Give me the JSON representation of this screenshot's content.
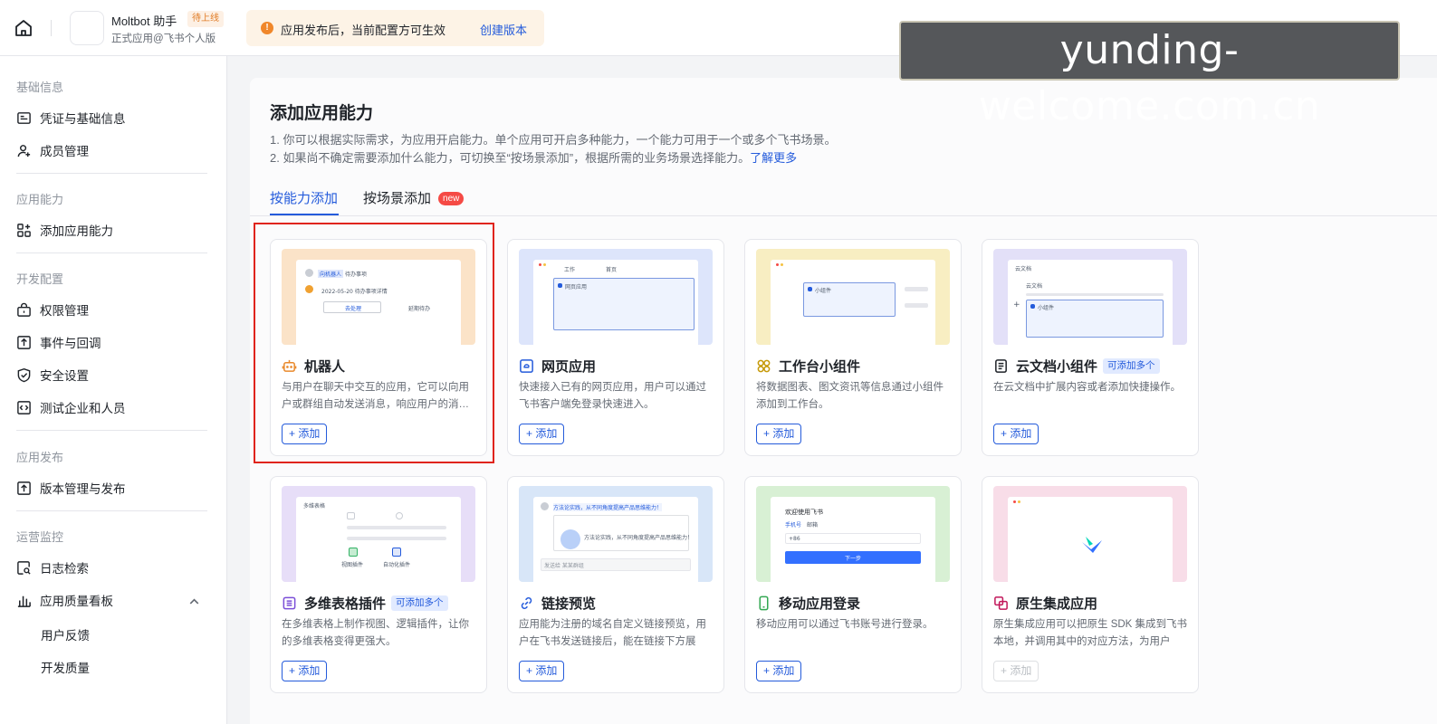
{
  "topbar": {
    "app_name": "Moltbot 助手",
    "app_status": "待上线",
    "app_subtitle": "正式应用@飞书个人版",
    "notice_text": "应用发布后，当前配置方可生效",
    "notice_link": "创建版本",
    "watermark": "yunding-welcome.com.cn"
  },
  "sidebar": {
    "groups": [
      {
        "label": "基础信息",
        "items": [
          {
            "label": "凭证与基础信息",
            "icon": "credential-icon"
          },
          {
            "label": "成员管理",
            "icon": "member-icon"
          }
        ]
      },
      {
        "label": "应用能力",
        "items": [
          {
            "label": "添加应用能力",
            "icon": "add-capability-icon"
          }
        ]
      },
      {
        "label": "开发配置",
        "items": [
          {
            "label": "权限管理",
            "icon": "permission-icon"
          },
          {
            "label": "事件与回调",
            "icon": "event-icon"
          },
          {
            "label": "安全设置",
            "icon": "shield-icon"
          },
          {
            "label": "测试企业和人员",
            "icon": "code-icon"
          }
        ]
      },
      {
        "label": "应用发布",
        "items": [
          {
            "label": "版本管理与发布",
            "icon": "upload-icon"
          }
        ]
      },
      {
        "label": "运营监控",
        "items": [
          {
            "label": "日志检索",
            "icon": "log-search-icon"
          },
          {
            "label": "应用质量看板",
            "icon": "chart-icon"
          }
        ]
      }
    ],
    "subitems": [
      "用户反馈",
      "开发质量"
    ]
  },
  "main": {
    "title": "添加应用能力",
    "desc_line1": "1. 你可以根据实际需求，为应用开启能力。单个应用可开启多种能力，一个能力可用于一个或多个飞书场景。",
    "desc_line2": "2. 如果尚不确定需要添加什么能力，可切换至“按场景添加”，根据所需的业务场景选择能力。",
    "desc_link": "了解更多",
    "tabs": [
      {
        "label": "按能力添加",
        "active": true
      },
      {
        "label": "按场景添加",
        "badge": "new"
      }
    ],
    "add_label": "+ 添加",
    "multi_label": "可添加多个",
    "cards": [
      {
        "title": "机器人",
        "desc": "与用户在聊天中交互的应用，它可以向用户或群组自动发送消息，响应用户的消…",
        "icon": "robot-icon",
        "thumb_bg": "#fbe3c8",
        "highlighted": true
      },
      {
        "title": "网页应用",
        "desc": "快速接入已有的网页应用，用户可以通过飞书客户端免登录快速进入。",
        "icon": "web-app-icon",
        "thumb_bg": "#dde5fb"
      },
      {
        "title": "工作台小组件",
        "desc": "将数据图表、图文资讯等信息通过小组件添加到工作台。",
        "icon": "widget-icon",
        "thumb_bg": "#f8eec2"
      },
      {
        "title": "云文档小组件",
        "desc": "在云文档中扩展内容或者添加快捷操作。",
        "icon": "doc-icon",
        "thumb_bg": "#e3e0f8",
        "multi": true
      },
      {
        "title": "多维表格插件",
        "desc": "在多维表格上制作视图、逻辑插件，让你的多维表格变得更强大。",
        "icon": "bitable-icon",
        "thumb_bg": "#e7def8",
        "multi": true
      },
      {
        "title": "链接预览",
        "desc": "应用能为注册的域名自定义链接预览，用户在飞书发送链接后，能在链接下方展示…",
        "icon": "link-icon",
        "thumb_bg": "#d8e6f8"
      },
      {
        "title": "移动应用登录",
        "desc": "移动应用可以通过飞书账号进行登录。",
        "icon": "mobile-icon",
        "thumb_bg": "#d8f0d4"
      },
      {
        "title": "原生集成应用",
        "desc": "原生集成应用可以把原生 SDK 集成到飞书本地，并调用其中的对应方法，为用户提…",
        "icon": "native-icon",
        "thumb_bg": "#f8dde8",
        "disabled": true
      }
    ],
    "thumb_text": {
      "robot_tag": "向机器人",
      "robot_todo": "待办事项",
      "robot_date": "2022-05-20 待办事项详情",
      "robot_btn1": "去处理",
      "robot_btn2": "延期待办",
      "web_tab1": "工作",
      "web_tab2": "首页",
      "web_app": "网页应用",
      "widget": "小组件",
      "doc_back": "云文档",
      "doc_title": "云文档",
      "doc_widget": "小组件",
      "bitable_title": "多维表格",
      "bitable_p1": "视图插件",
      "bitable_p2": "自动化插件",
      "link_msg": "方法论实践，从不同角度提高产品思维能力！",
      "link_reply": "方法论实践，从不同角度提高产品思维能力！",
      "link_input": "发送给 某某群组",
      "mobile_title": "欢迎使用飞书",
      "mobile_tab1": "手机号",
      "mobile_tab2": "邮箱",
      "mobile_code": "+86",
      "mobile_btn": "下一步"
    }
  }
}
